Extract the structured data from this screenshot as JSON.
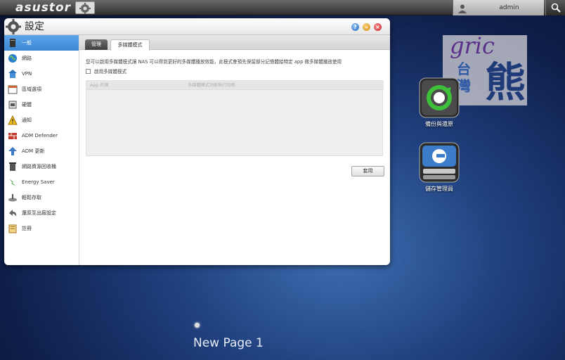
{
  "topbar": {
    "brand": "asustor",
    "username": "admin"
  },
  "window": {
    "title": "設定",
    "buttons": {
      "help": "?",
      "minimize": "–",
      "close": "×"
    }
  },
  "sidebar": {
    "items": [
      {
        "label": "一般",
        "icon": "server-icon"
      },
      {
        "label": "網路",
        "icon": "globe-icon"
      },
      {
        "label": "VPN",
        "icon": "house-network-icon"
      },
      {
        "label": "區域選項",
        "icon": "calendar-icon"
      },
      {
        "label": "硬體",
        "icon": "hardware-icon"
      },
      {
        "label": "通知",
        "icon": "warning-icon"
      },
      {
        "label": "ADM Defender",
        "icon": "firewall-icon"
      },
      {
        "label": "ADM 更新",
        "icon": "update-arrow-icon"
      },
      {
        "label": "網路資源回收桶",
        "icon": "recycle-bin-icon"
      },
      {
        "label": "Energy Saver",
        "icon": "energy-icon"
      },
      {
        "label": "輕鬆存取",
        "icon": "easy-access-icon"
      },
      {
        "label": "還原至出廠設定",
        "icon": "restore-icon"
      },
      {
        "label": "註冊",
        "icon": "register-icon"
      }
    ]
  },
  "content": {
    "tabs": [
      {
        "label": "管理"
      },
      {
        "label": "多媒體模式"
      }
    ],
    "description": "您可以啟用多媒體模式讓 NAS 可以得到更好的多媒體播放效能，此模式會預先保留部分記憶體給特定 app 做多媒體播放使用",
    "checkbox_label": "啟用多媒體模式",
    "table": {
      "col1": "App 名稱",
      "col2": "多媒體模式功能執行功能"
    },
    "apply_label": "套用"
  },
  "desktop": {
    "icons": [
      {
        "label": "備份與還原",
        "icon": "backup-restore-icon"
      },
      {
        "label": "儲存管理員",
        "icon": "storage-manager-icon"
      }
    ],
    "page_label": "New Page 1"
  },
  "watermark": {
    "text1": "gric",
    "text2": "台灣",
    "text3": "熊"
  }
}
